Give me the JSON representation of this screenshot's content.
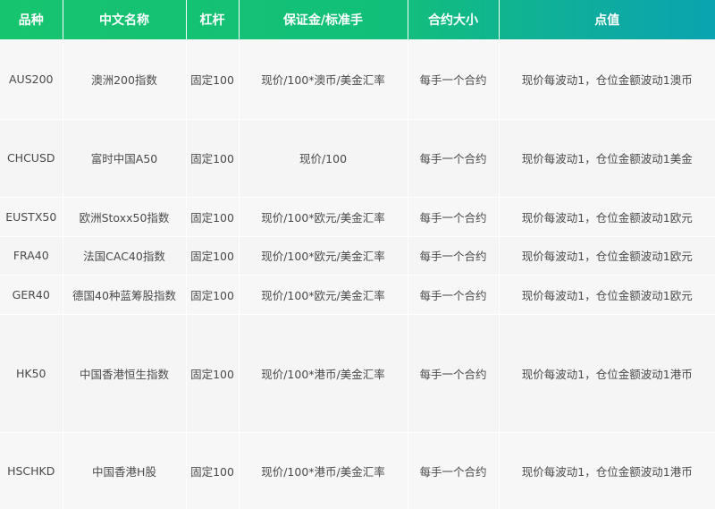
{
  "table": {
    "headers": [
      "品种",
      "中文名称",
      "杠杆",
      "保证金/标准手",
      "合约大小",
      "点值"
    ],
    "rows": [
      [
        "AUS200",
        "澳洲200指数",
        "固定100",
        "现价/100*澳币/美金汇率",
        "每手一个合约",
        "现价每波动1，仓位金额波动1澳币"
      ],
      [
        "CHCUSD",
        "富时中国A50",
        "固定100",
        "现价/100",
        "每手一个合约",
        "现价每波动1，仓位金额波动1美金"
      ],
      [
        "EUSTX50",
        "欧洲Stoxx50指数",
        "固定100",
        "现价/100*欧元/美金汇率",
        "每手一个合约",
        "现价每波动1，仓位金额波动1欧元"
      ],
      [
        "FRA40",
        "法国CAC40指数",
        "固定100",
        "现价/100*欧元/美金汇率",
        "每手一个合约",
        "现价每波动1，仓位金额波动1欧元"
      ],
      [
        "GER40",
        "德国40种蓝筹股指数",
        "固定100",
        "现价/100*欧元/美金汇率",
        "每手一个合约",
        "现价每波动1，仓位金额波动1欧元"
      ],
      [
        "HK50",
        "中国香港恒生指数",
        "固定100",
        "现价/100*港币/美金汇率",
        "每手一个合约",
        "现价每波动1，仓位金额波动1港币"
      ],
      [
        "HSCHKD",
        "中国香港H股",
        "固定100",
        "现价/100*港币/美金汇率",
        "每手一个合约",
        "现价每波动1，仓位金额波动1港币"
      ]
    ]
  },
  "colors": {
    "header_start": "#17c46e",
    "header_end": "#0aa3b0",
    "header_text": "#ffffff",
    "row_bg": "#f7f7f7",
    "cell_text": "#4a4a4a"
  }
}
